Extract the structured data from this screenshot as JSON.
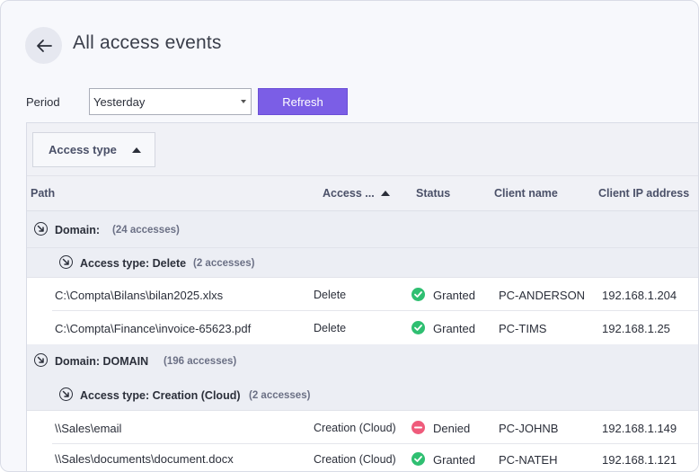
{
  "page": {
    "title": "All access events"
  },
  "filters": {
    "period_label": "Period",
    "period_value": "Yesterday",
    "refresh_label": "Refresh"
  },
  "grid": {
    "group_panel": {
      "chip_label": "Access type"
    },
    "columns": [
      "Path",
      "Access ...",
      "Status",
      "Client name",
      "Client IP address"
    ],
    "groups": [
      {
        "domain_label": "Domain:",
        "domain_name": "",
        "domain_count": "(24 accesses)",
        "subgroups": [
          {
            "type_label": "Access type: Delete",
            "type_count": "(2 accesses)",
            "rows": [
              {
                "path": "C:\\Compta\\Bilans\\bilan2025.xlxs",
                "access": "Delete",
                "status": "Granted",
                "status_icon": "check-circle-icon",
                "client": "PC-ANDERSON",
                "ip": "192.168.1.204"
              },
              {
                "path": "C:\\Compta\\Finance\\invoice-65623.pdf",
                "access": "Delete",
                "status": "Granted",
                "status_icon": "check-circle-icon",
                "client": "PC-TIMS",
                "ip": "192.168.1.25"
              }
            ]
          }
        ]
      },
      {
        "domain_label": "Domain: DOMAIN",
        "domain_count": "(196 accesses)",
        "subgroups": [
          {
            "type_label": "Access type: Creation (Cloud)",
            "type_count": "(2 accesses)",
            "rows": [
              {
                "path": "\\\\Sales\\email",
                "access": "Creation (Cloud)",
                "status": "Denied",
                "status_icon": "minus-circle-icon",
                "client": "PC-JOHNB",
                "ip": "192.168.1.149"
              },
              {
                "path": "\\\\Sales\\documents\\document.docx",
                "access": "Creation (Cloud)",
                "status": "Granted",
                "status_icon": "check-circle-icon",
                "client": "PC-NATEH",
                "ip": "192.168.1.121"
              }
            ]
          }
        ]
      }
    ]
  },
  "colors": {
    "accent": "#7b5ee6",
    "granted": "#2fbf71",
    "denied": "#ef5b7b"
  },
  "icons": {
    "back": "arrow-left-icon",
    "group_toggle": "collapse-arrow-icon",
    "sort": "sort-ascending-icon"
  }
}
